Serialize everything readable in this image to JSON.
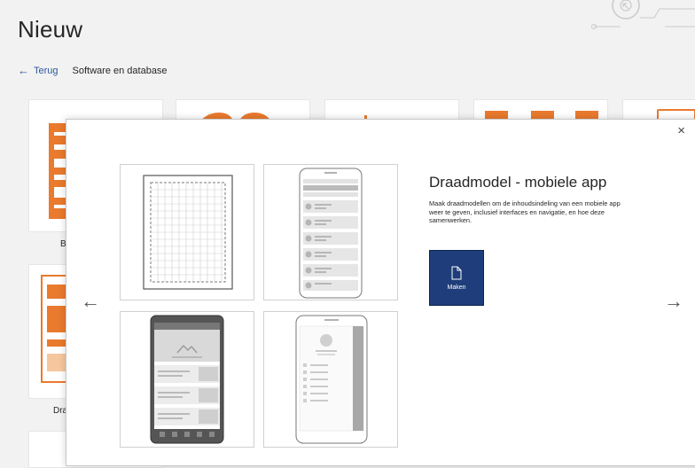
{
  "header": {
    "title": "Nieuw",
    "back_label": "Terug",
    "breadcrumb": "Software en database"
  },
  "background": {
    "labels": [
      "B",
      "Dra"
    ]
  },
  "modal": {
    "close_glyph": "×",
    "prev_glyph": "←",
    "next_glyph": "→",
    "title": "Draadmodel - mobiele app",
    "description": "Maak draadmodellen om de inhoudsindeling van een mobiele app weer te geven, inclusief interfaces en navigatie, en hoe deze samenwerken.",
    "create_label": "Maken"
  },
  "icons": [
    "back-arrow-icon",
    "close-icon",
    "prev-arrow-icon",
    "next-arrow-icon",
    "document-icon"
  ],
  "colors": {
    "accent_orange": "#e97a2e",
    "create_button": "#1e3d7a",
    "link": "#2b579a"
  }
}
